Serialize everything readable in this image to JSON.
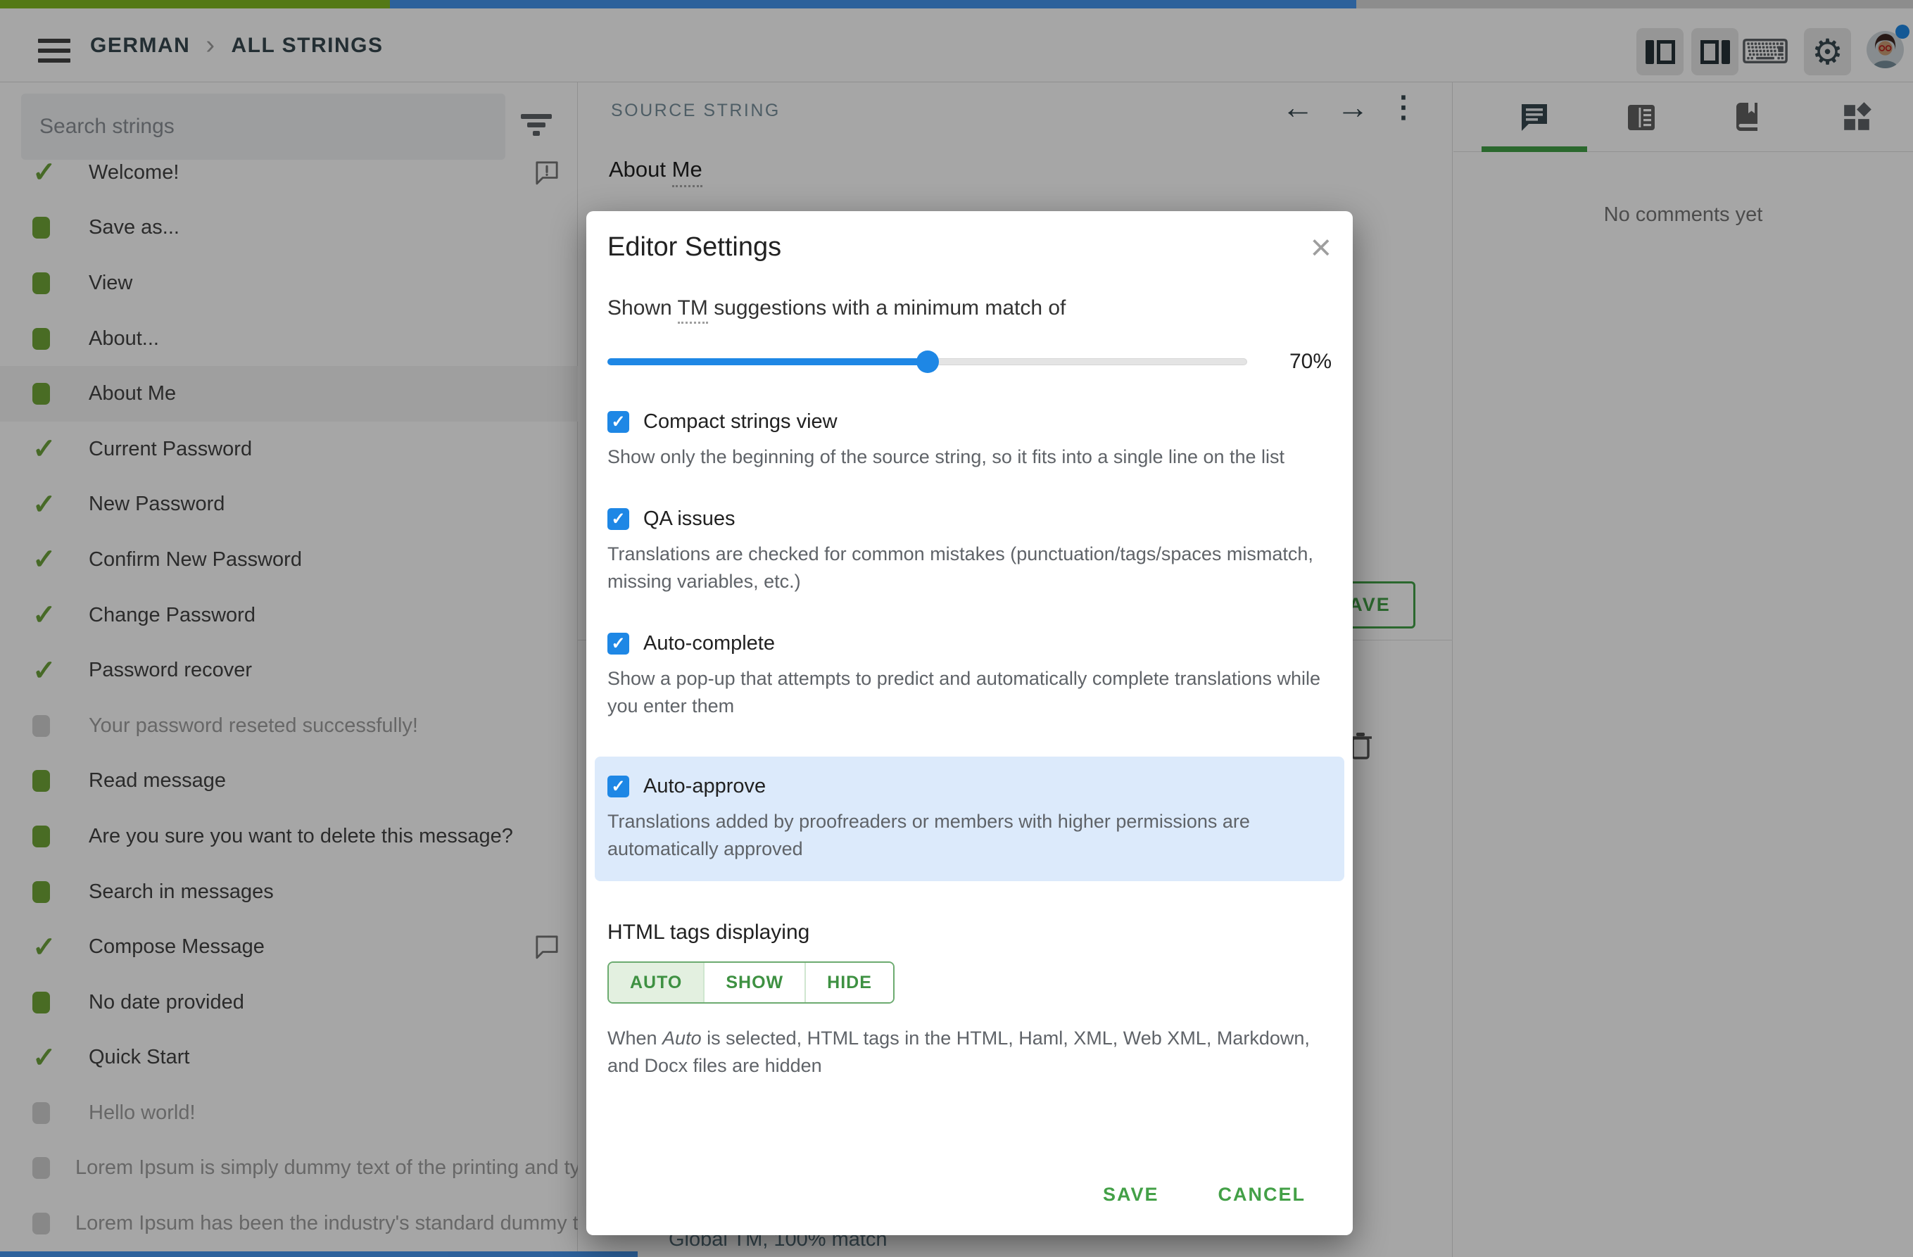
{
  "topbar": {
    "project": "GERMAN",
    "section": "ALL STRINGS",
    "progress": {
      "approved_width": 554,
      "translated_width": 1373
    }
  },
  "icons": {
    "chevron": "›",
    "back_arrow": "←",
    "forward_arrow": "→",
    "overflow": "⋮",
    "close": "×",
    "keyboard": "⌨",
    "gear": "⚙",
    "check": "✓"
  },
  "sidebar": {
    "search_placeholder": "Search strings",
    "items": [
      {
        "label": "Welcome!",
        "status": "approved",
        "comment": "issue"
      },
      {
        "label": "Save as...",
        "status": "translated"
      },
      {
        "label": "View",
        "status": "translated"
      },
      {
        "label": "About...",
        "status": "translated"
      },
      {
        "label": "About Me",
        "status": "translated",
        "selected": true
      },
      {
        "label": "Current Password",
        "status": "approved"
      },
      {
        "label": "New Password",
        "status": "approved"
      },
      {
        "label": "Confirm New Password",
        "status": "approved"
      },
      {
        "label": "Change Password",
        "status": "approved"
      },
      {
        "label": "Password recover",
        "status": "approved"
      },
      {
        "label": "Your password reseted successfully!",
        "status": "untranslated"
      },
      {
        "label": "Read message",
        "status": "translated"
      },
      {
        "label": "Are you sure you want to delete this message?",
        "status": "translated"
      },
      {
        "label": "Search in messages",
        "status": "translated"
      },
      {
        "label": "Compose Message",
        "status": "approved",
        "comment": "plain"
      },
      {
        "label": "No date provided",
        "status": "translated"
      },
      {
        "label": "Quick Start",
        "status": "approved"
      },
      {
        "label": "Hello world!",
        "status": "untranslated"
      },
      {
        "label": "Lorem Ipsum is simply dummy text of the printing and ty…",
        "status": "untranslated"
      },
      {
        "label": "Lorem Ipsum has been the industry's standard dummy t…",
        "status": "untranslated"
      }
    ]
  },
  "middle": {
    "header": "SOURCE STRING",
    "source_prefix": "About ",
    "source_abbr": "Me",
    "save_label": "SAVE",
    "tm_match": "Global TM, 100% match"
  },
  "right_panel": {
    "empty": "No comments yet"
  },
  "modal": {
    "title": "Editor Settings",
    "tm_pre": "Shown ",
    "tm_abbr": "TM",
    "tm_post": " suggestions with a minimum match of",
    "slider": {
      "value": "70%",
      "percent": 50
    },
    "options": [
      {
        "label": "Compact strings view",
        "desc": "Show only the beginning of the source string, so it fits into a single line on the list",
        "checked": true,
        "highlight": false
      },
      {
        "label": "QA issues",
        "desc": "Translations are checked for common mistakes (punctuation/tags/spaces mismatch, missing variables, etc.)",
        "checked": true,
        "highlight": false
      },
      {
        "label": "Auto-complete",
        "desc": "Show a pop-up that attempts to predict and automatically complete translations while you enter them",
        "checked": true,
        "highlight": false
      },
      {
        "label": "Auto-approve",
        "desc": "Translations added by proofreaders or members with higher permissions are automatically approved",
        "checked": true,
        "highlight": true
      }
    ],
    "html_tags": {
      "label": "HTML tags displaying",
      "options": [
        "AUTO",
        "SHOW",
        "HIDE"
      ],
      "selected": "AUTO",
      "desc_pre": "When ",
      "desc_italic": "Auto",
      "desc_post": " is selected, HTML tags in the HTML, Haml, XML, Web XML, Markdown, and Docx files are hidden"
    },
    "save_label": "SAVE",
    "cancel_label": "CANCEL"
  },
  "colors": {
    "accent_blue": "#1e87e5",
    "action_green": "#43a047",
    "approved": "#6da33c",
    "translated": "#70a738",
    "untranslated": "#d2d2d2",
    "progress_approved": "#81ba23",
    "progress_translated": "#4596ef",
    "highlight_bg": "#dceafb"
  }
}
